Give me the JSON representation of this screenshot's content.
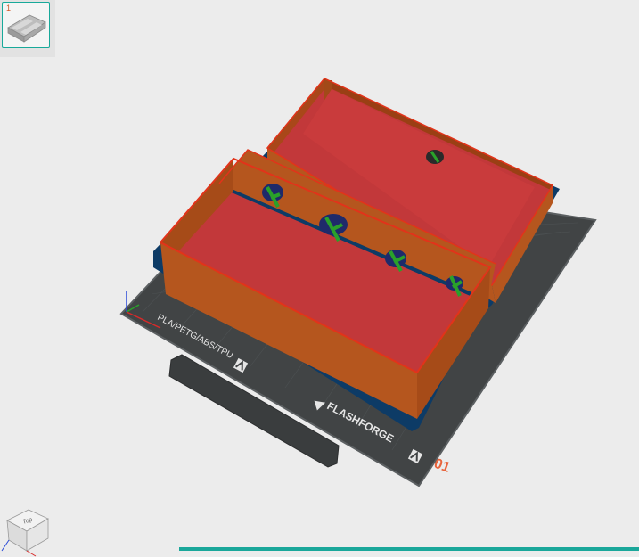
{
  "object_list": {
    "thumbnail_index": "1"
  },
  "build_plate": {
    "material_label": "PLA/PETG/ABS/TPU",
    "brand": "FLASHFORGE",
    "plate_number": "01"
  },
  "view_cube": {
    "face_label": "Top"
  },
  "colors": {
    "background": "#ececec",
    "plate": "#3f4243",
    "plate_border": "#5a5e60",
    "object_wall": "#b5561e",
    "object_floor": "#c2383a",
    "object_outline": "#e2331a",
    "support": "#2aa12a",
    "first_layer": "#0d3b66",
    "accent": "#1aa79a",
    "plate_number": "#e8643c"
  },
  "progress": {
    "value": 1.0
  }
}
